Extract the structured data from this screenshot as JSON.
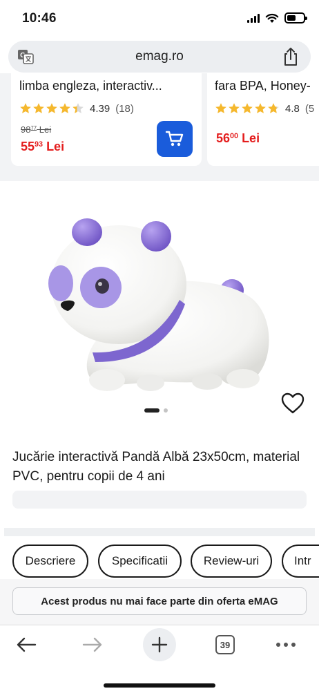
{
  "status_bar": {
    "time": "10:46",
    "icons": [
      "cellular-signal-icon",
      "wifi-icon",
      "battery-icon"
    ],
    "battery_level": 0.55
  },
  "browser": {
    "url": "emag.ro",
    "translate_icon": "translate-icon",
    "share_icon": "share-icon"
  },
  "recommendations": [
    {
      "title": "limba engleza, interactiv...",
      "rating": "4.39",
      "rating_value": 4.39,
      "review_count": "(18)",
      "old_price_main": "98",
      "old_price_cents": "77",
      "old_price_currency": "Lei",
      "price_main": "55",
      "price_cents": "93",
      "price_currency": "Lei",
      "cart_icon": "cart-icon"
    },
    {
      "title": "fara BPA, Honey-",
      "rating": "4.8",
      "rating_value": 4.8,
      "review_count": "(5",
      "price_main": "56",
      "price_cents": "00",
      "price_currency": "Lei"
    }
  ],
  "product": {
    "title": "Jucărie interactivă Pandă Albă 23x50cm, material PVC, pentru copii de 4 ani",
    "image_count": 2,
    "active_image": 1,
    "favorite_icon": "heart-icon"
  },
  "tabs": [
    {
      "label": "Descriere"
    },
    {
      "label": "Specificatii"
    },
    {
      "label": "Review-uri"
    },
    {
      "label": "Intr"
    }
  ],
  "notice": "Acest produs nu mai face parte din oferta eMAG",
  "toolbar": {
    "back_icon": "arrow-left-icon",
    "forward_icon": "arrow-right-icon",
    "new_tab_icon": "plus-icon",
    "tab_count": "39",
    "menu_icon": "more-dots-icon"
  },
  "colors": {
    "price_red": "#e41d1d",
    "cart_blue": "#1a5cdb",
    "star_gold": "#f5b82e",
    "panda_purple": "#8d73d6"
  }
}
